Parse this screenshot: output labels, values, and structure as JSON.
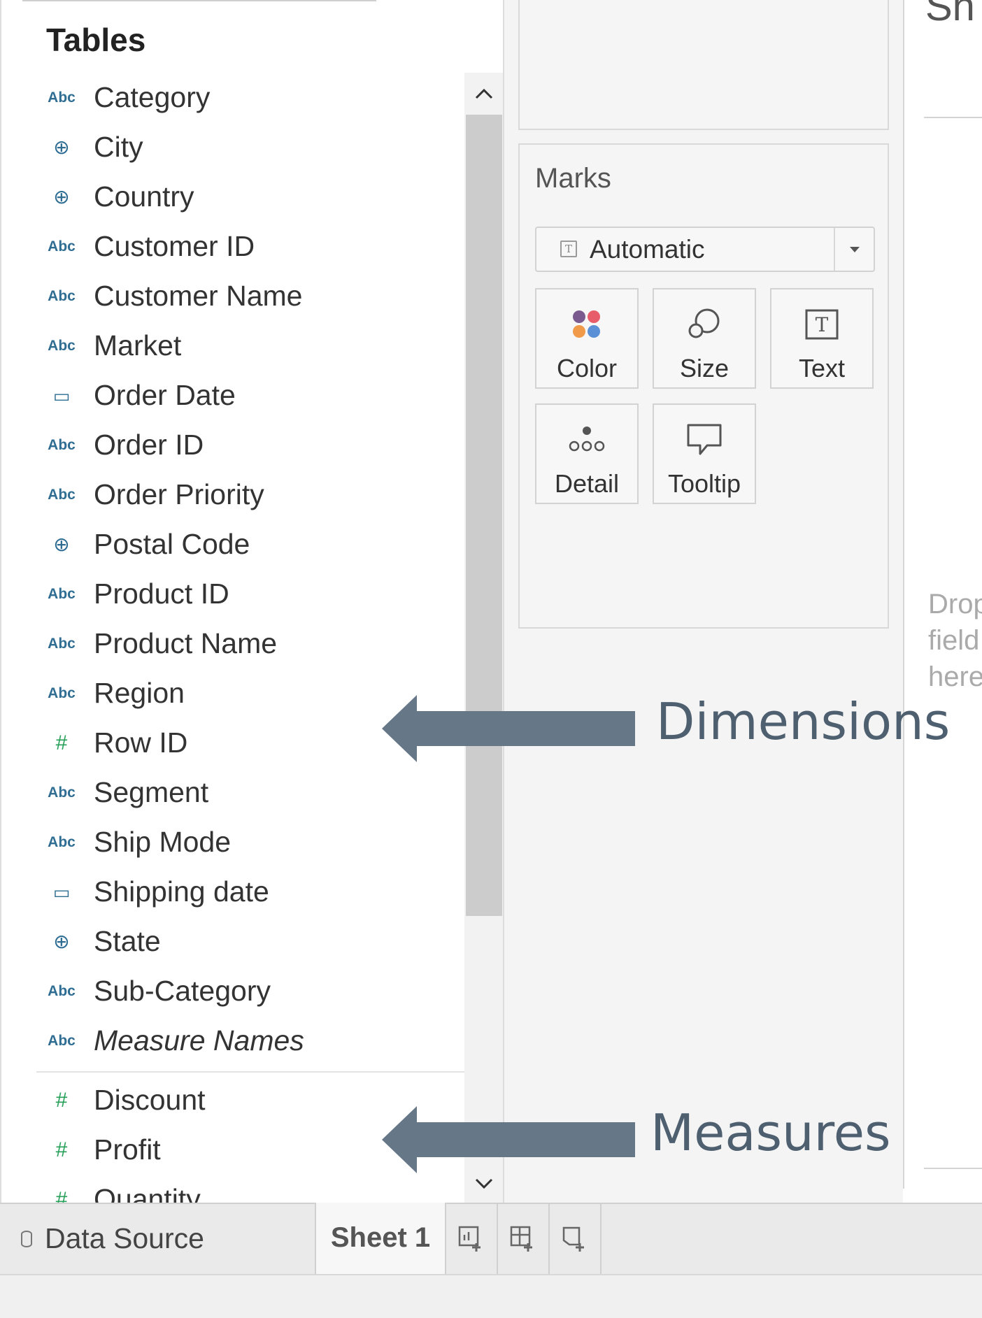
{
  "data_pane": {
    "heading": "Tables",
    "dimensions": [
      {
        "label": "Category",
        "type": "abc",
        "icon": "string-type-icon",
        "glyph": "Abc"
      },
      {
        "label": "City",
        "type": "geo",
        "icon": "globe-icon",
        "glyph": "🌐"
      },
      {
        "label": "Country",
        "type": "geo",
        "icon": "globe-icon",
        "glyph": "🌐"
      },
      {
        "label": "Customer ID",
        "type": "abc",
        "icon": "string-type-icon",
        "glyph": "Abc"
      },
      {
        "label": "Customer Name",
        "type": "abc",
        "icon": "string-type-icon",
        "glyph": "Abc"
      },
      {
        "label": "Market",
        "type": "abc",
        "icon": "string-type-icon",
        "glyph": "Abc"
      },
      {
        "label": "Order Date",
        "type": "date",
        "icon": "calendar-icon",
        "glyph": "📅"
      },
      {
        "label": "Order ID",
        "type": "abc",
        "icon": "string-type-icon",
        "glyph": "Abc"
      },
      {
        "label": "Order Priority",
        "type": "abc",
        "icon": "string-type-icon",
        "glyph": "Abc"
      },
      {
        "label": "Postal Code",
        "type": "geo",
        "icon": "globe-icon",
        "glyph": "🌐"
      },
      {
        "label": "Product ID",
        "type": "abc",
        "icon": "string-type-icon",
        "glyph": "Abc"
      },
      {
        "label": "Product Name",
        "type": "abc",
        "icon": "string-type-icon",
        "glyph": "Abc"
      },
      {
        "label": "Region",
        "type": "abc",
        "icon": "string-type-icon",
        "glyph": "Abc"
      },
      {
        "label": "Row ID",
        "type": "num",
        "icon": "number-type-icon",
        "glyph": "#"
      },
      {
        "label": "Segment",
        "type": "abc",
        "icon": "string-type-icon",
        "glyph": "Abc"
      },
      {
        "label": "Ship Mode",
        "type": "abc",
        "icon": "string-type-icon",
        "glyph": "Abc"
      },
      {
        "label": "Shipping date",
        "type": "date",
        "icon": "calendar-icon",
        "glyph": "📅"
      },
      {
        "label": "State",
        "type": "geo",
        "icon": "globe-icon",
        "glyph": "🌐"
      },
      {
        "label": "Sub-Category",
        "type": "abc",
        "icon": "string-type-icon",
        "glyph": "Abc"
      },
      {
        "label": "Measure Names",
        "type": "abc",
        "icon": "string-type-icon",
        "glyph": "Abc",
        "italic": true
      }
    ],
    "measures": [
      {
        "label": "Discount",
        "type": "num",
        "icon": "number-type-icon",
        "glyph": "#"
      },
      {
        "label": "Profit",
        "type": "num",
        "icon": "number-type-icon",
        "glyph": "#"
      },
      {
        "label": "Quantity",
        "type": "num",
        "icon": "number-type-icon",
        "glyph": "#"
      }
    ]
  },
  "marks": {
    "title": "Marks",
    "mark_type": "Automatic",
    "buttons": [
      {
        "label": "Color",
        "icon": "color-icon"
      },
      {
        "label": "Size",
        "icon": "size-icon"
      },
      {
        "label": "Text",
        "icon": "text-icon"
      },
      {
        "label": "Detail",
        "icon": "detail-icon"
      },
      {
        "label": "Tooltip",
        "icon": "tooltip-icon"
      }
    ]
  },
  "view": {
    "title": "Sh",
    "drop_text": "Drop\nfield\nhere"
  },
  "annotations": {
    "dimensions": "Dimensions",
    "measures": "Measures",
    "arrow_color": "#667788"
  },
  "tabs": {
    "data_source": "Data Source",
    "sheet": "Sheet 1",
    "tools": [
      "new-worksheet-icon",
      "new-dashboard-icon",
      "new-story-icon"
    ]
  },
  "colors": {
    "abc_icon": "#2f6d93",
    "number_icon": "#28a05a",
    "annotation_text": "#4e5f70"
  }
}
